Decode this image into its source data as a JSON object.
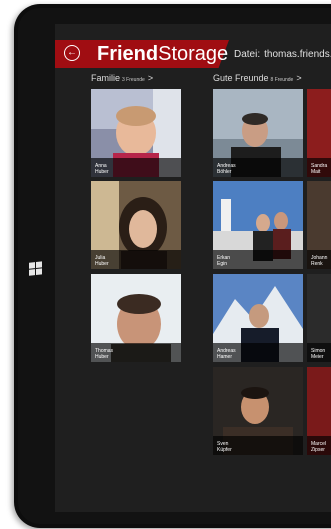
{
  "app": {
    "title_bold": "Friend",
    "title_light": "Storage",
    "file_label": "Datei:",
    "file_name": "thomas.friends..."
  },
  "colors": {
    "accent": "#a00d12",
    "background": "#1f1f1f"
  },
  "icons": {
    "back": "back-arrow-icon",
    "windows": "windows-logo-icon"
  },
  "groups": [
    {
      "name": "Familie",
      "count": "3 Freunde",
      "chevron": ">",
      "friends": [
        {
          "first": "Anna",
          "last": "Huber"
        },
        {
          "first": "Julia",
          "last": "Huber"
        },
        {
          "first": "Thomas",
          "last": "Huber"
        }
      ]
    },
    {
      "name": "Gute Freunde",
      "count": "8 Freunde",
      "chevron": ">",
      "friends": [
        {
          "first": "Andreas",
          "last": "Böhler"
        },
        {
          "first": "Erkan",
          "last": "Egin"
        },
        {
          "first": "Andreas",
          "last": "Hamer"
        },
        {
          "first": "Sven",
          "last": "Küpfer"
        },
        {
          "first": "Sandra",
          "last": "Mait"
        },
        {
          "first": "Johann",
          "last": "Renk"
        },
        {
          "first": "Simon",
          "last": "Meier"
        },
        {
          "first": "Marcel",
          "last": "Zipser"
        }
      ]
    }
  ]
}
